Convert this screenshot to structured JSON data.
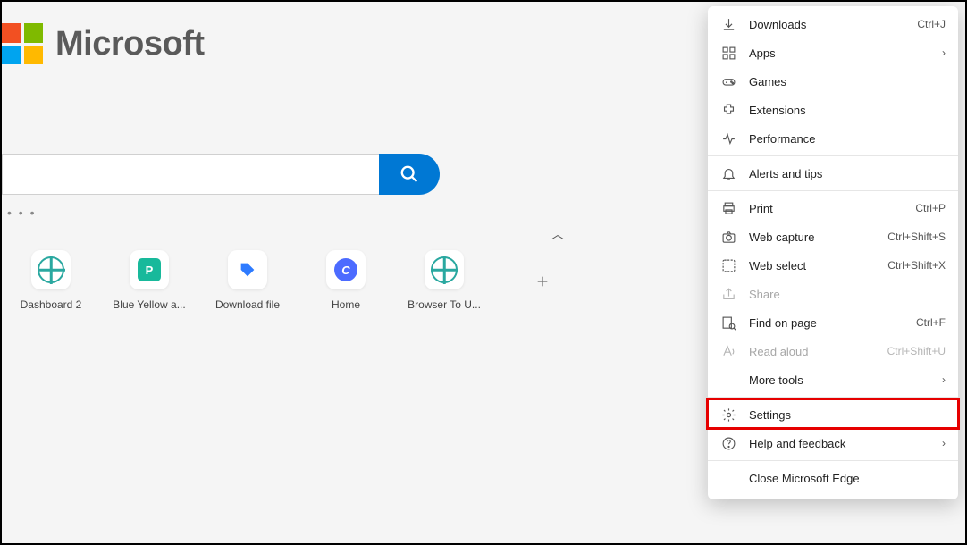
{
  "header": {
    "brand": "Microsoft"
  },
  "search": {
    "placeholder": ""
  },
  "quicklinks": [
    {
      "label": "Dashboard 2",
      "icon": "globe-icon"
    },
    {
      "label": "Blue Yellow a...",
      "icon": "p-box-icon"
    },
    {
      "label": "Download file",
      "icon": "tag-icon"
    },
    {
      "label": "Home",
      "icon": "c-circle-icon"
    },
    {
      "label": "Browser To U...",
      "icon": "globe-icon"
    }
  ],
  "menu": {
    "items": [
      {
        "label": "Downloads",
        "shortcut": "Ctrl+J",
        "icon": "download-icon"
      },
      {
        "label": "Apps",
        "submenu": true,
        "icon": "apps-icon"
      },
      {
        "label": "Games",
        "icon": "games-icon"
      },
      {
        "label": "Extensions",
        "icon": "extensions-icon"
      },
      {
        "label": "Performance",
        "icon": "performance-icon"
      },
      {
        "label": "Alerts and tips",
        "icon": "bell-icon"
      },
      {
        "label": "Print",
        "shortcut": "Ctrl+P",
        "icon": "print-icon"
      },
      {
        "label": "Web capture",
        "shortcut": "Ctrl+Shift+S",
        "icon": "camera-icon"
      },
      {
        "label": "Web select",
        "shortcut": "Ctrl+Shift+X",
        "icon": "web-select-icon"
      },
      {
        "label": "Share",
        "disabled": true,
        "icon": "share-icon"
      },
      {
        "label": "Find on page",
        "shortcut": "Ctrl+F",
        "icon": "find-icon"
      },
      {
        "label": "Read aloud",
        "shortcut": "Ctrl+Shift+U",
        "disabled": true,
        "icon": "read-aloud-icon"
      },
      {
        "label": "More tools",
        "submenu": true
      },
      {
        "label": "Settings",
        "highlighted": true,
        "icon": "gear-icon"
      },
      {
        "label": "Help and feedback",
        "submenu": true,
        "icon": "help-icon"
      },
      {
        "label": "Close Microsoft Edge"
      }
    ]
  },
  "colors": {
    "accent": "#0078d4",
    "highlight_border": "#e60000"
  }
}
